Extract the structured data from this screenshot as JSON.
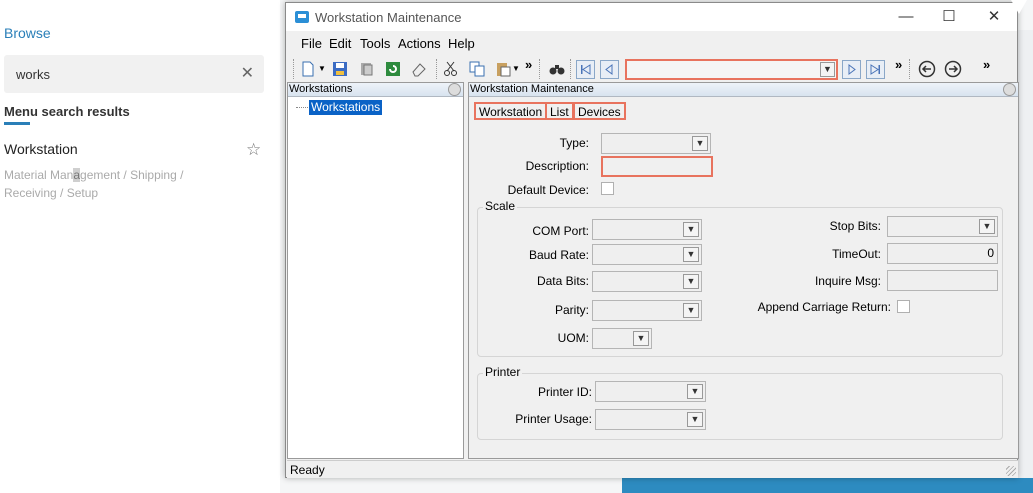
{
  "browse": {
    "title": "Browse",
    "search_value": "works",
    "results_heading": "Menu search results",
    "result_title": "Workstation",
    "result_path_before": "Material Man",
    "result_path_highlight": "a",
    "result_path_after": "gement / Shipping / Receiving / Setup"
  },
  "window": {
    "title": "Workstation Maintenance",
    "menu": [
      "File",
      "Edit",
      "Tools",
      "Actions",
      "Help"
    ],
    "overflow": "»"
  },
  "tree": {
    "header": "Workstations",
    "node": "Workstations"
  },
  "main": {
    "header": "Workstation Maintenance",
    "tabs": [
      "Workstation",
      "List",
      "Devices"
    ],
    "type_label": "Type:",
    "description_label": "Description:",
    "default_device_label": "Default Device:",
    "scale_group": "Scale",
    "com_port_label": "COM Port:",
    "baud_rate_label": "Baud Rate:",
    "data_bits_label": "Data Bits:",
    "parity_label": "Parity:",
    "uom_label": "UOM:",
    "stop_bits_label": "Stop Bits:",
    "timeout_label": "TimeOut:",
    "timeout_value": "0",
    "inquire_msg_label": "Inquire Msg:",
    "append_cr_label": "Append Carriage Return:",
    "printer_group": "Printer",
    "printer_id_label": "Printer ID:",
    "printer_usage_label": "Printer Usage:"
  },
  "status": "Ready",
  "colors": {
    "highlight_border": "#e8735e",
    "selection": "#0a62c6",
    "link_blue": "#2a7fb8"
  }
}
